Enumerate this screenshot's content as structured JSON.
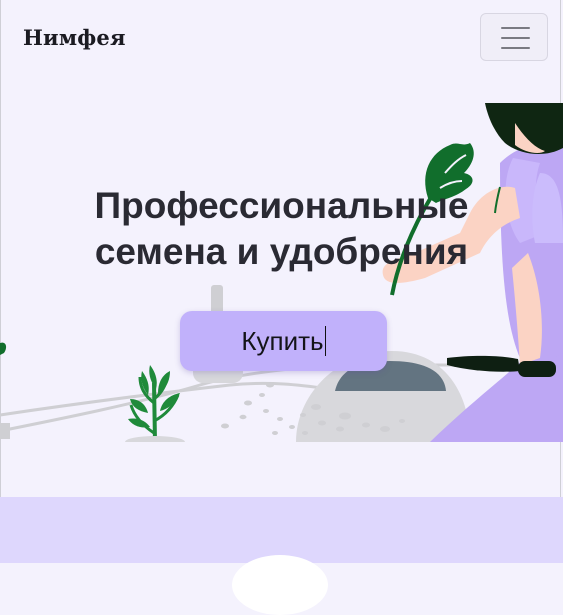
{
  "navbar": {
    "brand": "Нимфея",
    "menu_icon": "hamburger-menu-icon"
  },
  "hero": {
    "title_line1": "Профессиональные",
    "title_line2": "семена и удобрения",
    "buy_label": "Купить"
  },
  "colors": {
    "background": "#f4f2fd",
    "accent": "#c1b1fb",
    "lower_section": "#ded7fd",
    "leaf_green": "#116e2c",
    "dress_purple": "#bda7f4"
  }
}
